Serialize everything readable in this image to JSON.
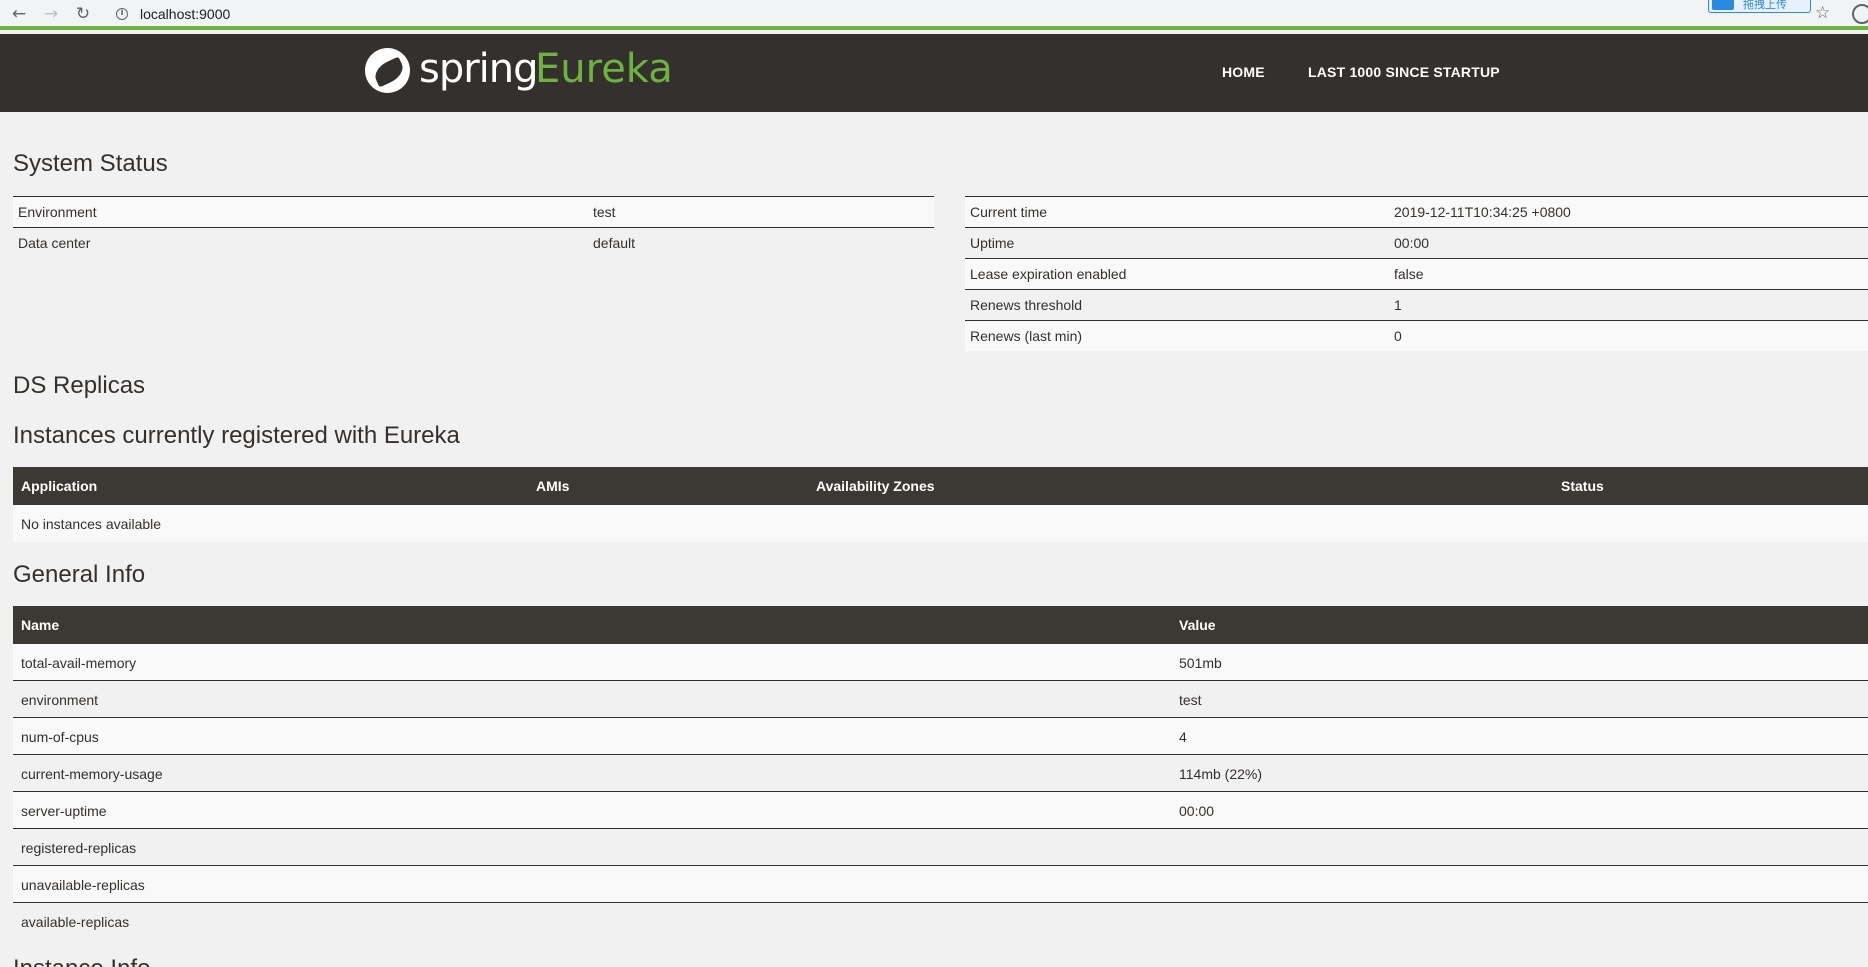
{
  "browser": {
    "url": "localhost:9000",
    "back_icon": "←",
    "forward_icon": "→",
    "reload_icon": "↻",
    "info_icon": "i",
    "star_icon": "☆",
    "extension_label": "拖拽上传"
  },
  "header": {
    "logo_text": "spring",
    "logo_accent": "Eureka",
    "nav": [
      "HOME",
      "LAST 1000 SINCE STARTUP"
    ]
  },
  "system_status": {
    "title": "System Status",
    "left": [
      {
        "label": "Environment",
        "value": "test"
      },
      {
        "label": "Data center",
        "value": "default"
      }
    ],
    "right": [
      {
        "label": "Current time",
        "value": "2019-12-11T10:34:25 +0800"
      },
      {
        "label": "Uptime",
        "value": "00:00"
      },
      {
        "label": "Lease expiration enabled",
        "value": "false"
      },
      {
        "label": "Renews threshold",
        "value": "1"
      },
      {
        "label": "Renews (last min)",
        "value": "0"
      }
    ]
  },
  "ds_replicas": {
    "title": "DS Replicas"
  },
  "instances": {
    "title": "Instances currently registered with Eureka",
    "columns": [
      "Application",
      "AMIs",
      "Availability Zones",
      "Status"
    ],
    "empty_text": "No instances available"
  },
  "general_info": {
    "title": "General Info",
    "columns": [
      "Name",
      "Value"
    ],
    "rows": [
      {
        "name": "total-avail-memory",
        "value": "501mb"
      },
      {
        "name": "environment",
        "value": "test"
      },
      {
        "name": "num-of-cpus",
        "value": "4"
      },
      {
        "name": "current-memory-usage",
        "value": "114mb (22%)"
      },
      {
        "name": "server-uptime",
        "value": "00:00"
      },
      {
        "name": "registered-replicas",
        "value": ""
      },
      {
        "name": "unavailable-replicas",
        "value": ""
      },
      {
        "name": "available-replicas",
        "value": ""
      }
    ]
  },
  "instance_info": {
    "title": "Instance Info"
  },
  "colors": {
    "accent": "#6db33f",
    "dark": "#34302d",
    "table_header": "#3c3834"
  }
}
